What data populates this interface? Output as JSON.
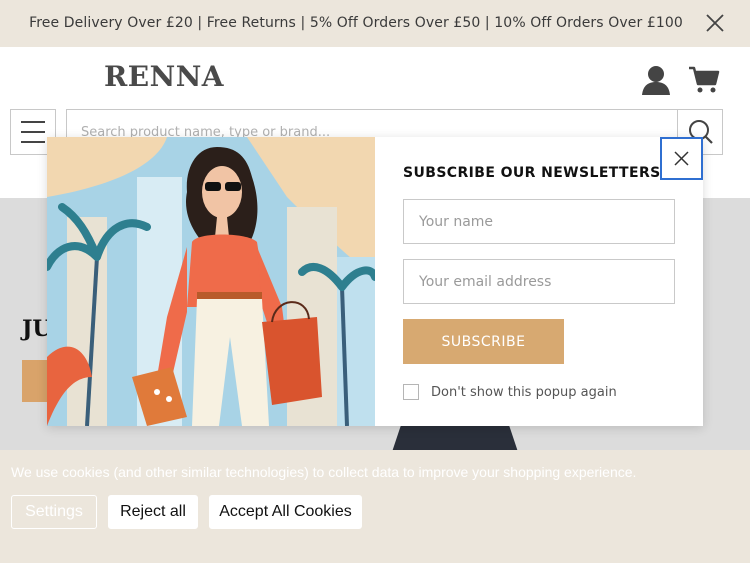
{
  "announcement": {
    "text": "Free Delivery Over £20  | Free Returns | 5% Off Orders Over £50 | 10% Off Orders Over £100"
  },
  "header": {
    "logo": "RENNA",
    "search_placeholder": "Search product name, type or brand..."
  },
  "hero": {
    "heading": "JU"
  },
  "modal": {
    "title": "SUBSCRIBE OUR NEWSLETTERS",
    "name_placeholder": "Your name",
    "email_placeholder": "Your email address",
    "subscribe_label": "SUBSCRIBE",
    "dont_show_label": "Don't show this popup again"
  },
  "cookie": {
    "text": "We use cookies (and other similar technologies) to collect data to improve your shopping experience.",
    "settings_label": "Settings",
    "reject_label": "Reject all",
    "accept_label": "Accept All Cookies"
  },
  "colors": {
    "accent": "#d7a971",
    "announce_bg": "#ece6dc",
    "focus_blue": "#2f6fd1"
  },
  "icons": {
    "announce_close": "close-icon",
    "account": "user-icon",
    "cart": "cart-icon",
    "menu": "hamburger-icon",
    "search": "search-icon",
    "modal_close": "close-icon"
  }
}
